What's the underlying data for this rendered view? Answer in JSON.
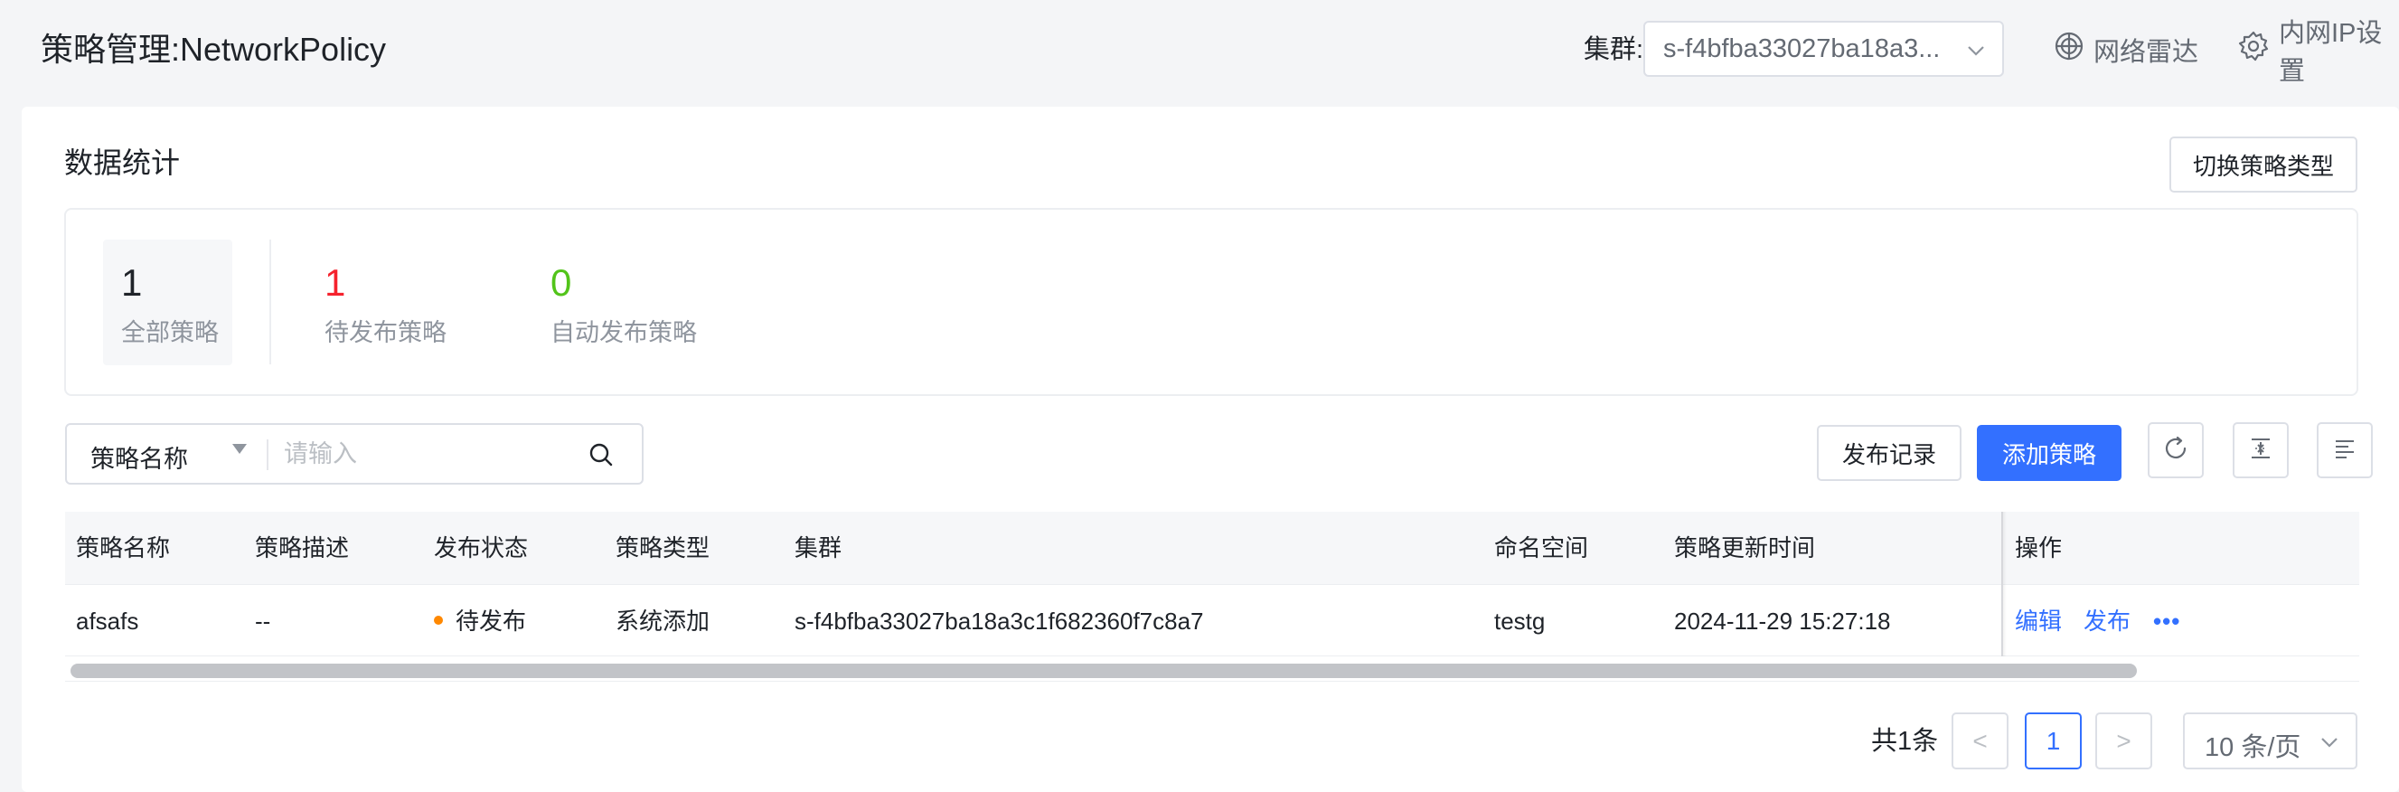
{
  "header": {
    "title": "策略管理:NetworkPolicy",
    "cluster_label": "集群:",
    "cluster_value": "s-f4bfba33027ba18a3...",
    "links": [
      {
        "label": "网络雷达",
        "icon": "radar-icon"
      },
      {
        "label": "内网IP设置",
        "icon": "gear-icon"
      }
    ]
  },
  "stats": {
    "section_title": "数据统计",
    "switch_button": "切换策略类型",
    "items": [
      {
        "value": "1",
        "label": "全部策略",
        "color": "#1f2329"
      },
      {
        "value": "1",
        "label": "待发布策略",
        "color": "#f5222d"
      },
      {
        "value": "0",
        "label": "自动发布策略",
        "color": "#52c41a"
      }
    ]
  },
  "toolbar": {
    "search_field": "策略名称",
    "search_placeholder": "请输入",
    "publish_log_button": "发布记录",
    "add_policy_button": "添加策略",
    "icons": [
      "refresh-icon",
      "density-icon",
      "column-settings-icon"
    ]
  },
  "table": {
    "columns": [
      "策略名称",
      "策略描述",
      "发布状态",
      "策略类型",
      "集群",
      "命名空间",
      "策略更新时间",
      "操作"
    ],
    "rows": [
      {
        "name": "afsafs",
        "description": "--",
        "status": "待发布",
        "status_color": "#ff8800",
        "type": "系统添加",
        "cluster": "s-f4bfba33027ba18a3c1f682360f7c8a7",
        "namespace": "testg",
        "updated": "2024-11-29 15:27:18",
        "actions": [
          "编辑",
          "发布",
          "•••"
        ]
      }
    ]
  },
  "pagination": {
    "total": "共1条",
    "prev": "<",
    "current": "1",
    "next": ">",
    "page_size": "10 条/页"
  },
  "colors": {
    "primary": "#3370ff",
    "pending": "#ff8800",
    "danger": "#f5222d",
    "success": "#52c41a"
  }
}
